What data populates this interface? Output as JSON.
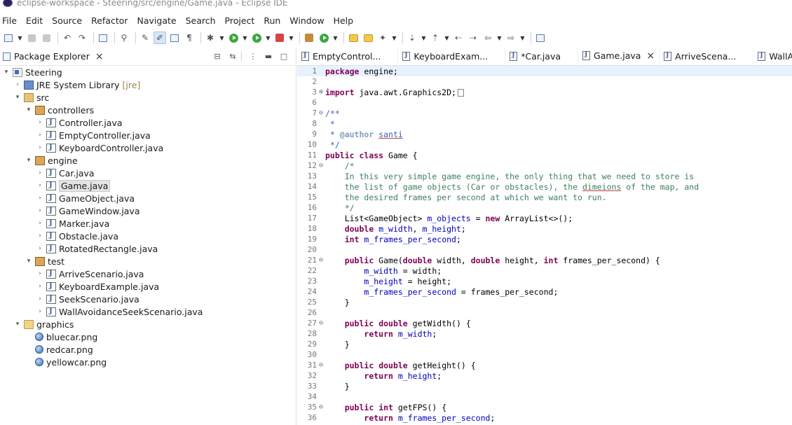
{
  "window": {
    "title": "eclipse-workspace - Steering/src/engine/Game.java - Eclipse IDE"
  },
  "menubar": {
    "items": [
      "File",
      "Edit",
      "Source",
      "Refactor",
      "Navigate",
      "Search",
      "Project",
      "Run",
      "Window",
      "Help"
    ]
  },
  "toolbar": {
    "icons": [
      "new-icon",
      "save-icon",
      "save-all-icon",
      "undo-icon",
      "redo-icon",
      "terminal-icon",
      "toggle-breakpoint-icon",
      "open-type-icon",
      "mark-occurrences-icon",
      "show-whitespace-icon",
      "debug-icon",
      "run-icon",
      "run-coverage-icon",
      "external-tools-icon",
      "new-java-package-icon",
      "new-java-class-icon",
      "open-task-icon",
      "search-icon",
      "next-annotation-icon",
      "previous-annotation-icon",
      "last-edit-icon",
      "back-icon",
      "forward-icon",
      "pin-editor-icon"
    ]
  },
  "explorer": {
    "tab_label": "Package Explorer",
    "tree": [
      {
        "label": "Steering",
        "icon": "project-icon",
        "level": 0,
        "expanded": true
      },
      {
        "label": "JRE System Library",
        "decoration": "[jre]",
        "icon": "library-icon",
        "level": 1,
        "expanded": false
      },
      {
        "label": "src",
        "icon": "source-folder-icon",
        "level": 1,
        "expanded": true
      },
      {
        "label": "controllers",
        "icon": "package-icon",
        "level": 2,
        "expanded": true
      },
      {
        "label": "Controller.java",
        "icon": "java-file-icon",
        "level": 3,
        "expanded": false
      },
      {
        "label": "EmptyController.java",
        "icon": "java-file-icon",
        "level": 3,
        "expanded": false
      },
      {
        "label": "KeyboardController.java",
        "icon": "java-file-icon",
        "level": 3,
        "expanded": false
      },
      {
        "label": "engine",
        "icon": "package-icon",
        "level": 2,
        "expanded": true
      },
      {
        "label": "Car.java",
        "icon": "java-file-icon",
        "level": 3,
        "expanded": false
      },
      {
        "label": "Game.java",
        "icon": "java-file-icon",
        "level": 3,
        "expanded": false,
        "selected": true
      },
      {
        "label": "GameObject.java",
        "icon": "java-file-icon",
        "level": 3,
        "expanded": false
      },
      {
        "label": "GameWindow.java",
        "icon": "java-file-icon",
        "level": 3,
        "expanded": false
      },
      {
        "label": "Marker.java",
        "icon": "java-file-icon",
        "level": 3,
        "expanded": false
      },
      {
        "label": "Obstacle.java",
        "icon": "java-file-icon",
        "level": 3,
        "expanded": false
      },
      {
        "label": "RotatedRectangle.java",
        "icon": "java-file-icon",
        "level": 3,
        "expanded": false
      },
      {
        "label": "test",
        "icon": "package-icon",
        "level": 2,
        "expanded": true
      },
      {
        "label": "ArriveScenario.java",
        "icon": "java-file-icon",
        "level": 3,
        "expanded": false
      },
      {
        "label": "KeyboardExample.java",
        "icon": "java-file-icon",
        "level": 3,
        "expanded": false
      },
      {
        "label": "SeekScenario.java",
        "icon": "java-file-icon",
        "level": 3,
        "expanded": false
      },
      {
        "label": "WallAvoidanceSeekScenario.java",
        "icon": "java-file-icon",
        "level": 3,
        "expanded": false
      },
      {
        "label": "graphics",
        "icon": "folder-icon",
        "level": 1,
        "expanded": true
      },
      {
        "label": "bluecar.png",
        "icon": "image-file-icon",
        "level": 2,
        "leaf": true
      },
      {
        "label": "redcar.png",
        "icon": "image-file-icon",
        "level": 2,
        "leaf": true
      },
      {
        "label": "yellowcar.png",
        "icon": "image-file-icon",
        "level": 2,
        "leaf": true
      }
    ]
  },
  "editor": {
    "tabs": [
      {
        "label": "EmptyControl...",
        "active": false
      },
      {
        "label": "KeyboardExam...",
        "active": false
      },
      {
        "label": "*Car.java",
        "active": false
      },
      {
        "label": "Game.java",
        "active": true
      },
      {
        "label": "ArriveScena...",
        "active": false
      },
      {
        "label": "WallAvoidanc...",
        "active": false
      }
    ],
    "lines": [
      {
        "n": "1",
        "fold": "",
        "html": "<span class=\"kw\">package</span> engine;",
        "current": true
      },
      {
        "n": "2",
        "fold": "",
        "html": ""
      },
      {
        "n": "3",
        "fold": "⊕",
        "html": "<span class=\"kw\">import</span> java.awt.Graphics2D;<span class=\"folded-box\"></span>"
      },
      {
        "n": "6",
        "fold": "",
        "html": ""
      },
      {
        "n": "7",
        "fold": "⊖",
        "html": "<span class=\"jd\">/**</span>"
      },
      {
        "n": "8",
        "fold": "",
        "html": "<span class=\"jd\"> *</span>"
      },
      {
        "n": "9",
        "fold": "",
        "html": "<span class=\"jd\"> * </span><span class=\"jdtag\">@author</span><span class=\"jd\"> <span class=\"ul\">santi</span></span>"
      },
      {
        "n": "10",
        "fold": "",
        "html": "<span class=\"jd\"> */</span>"
      },
      {
        "n": "11",
        "fold": "",
        "html": "<span class=\"kw\">public</span> <span class=\"kw\">class</span> Game {"
      },
      {
        "n": "12",
        "fold": "⊖",
        "html": "    <span class=\"cm\">/*</span>"
      },
      {
        "n": "13",
        "fold": "",
        "html": "    <span class=\"cm\">In this very simple game engine, the only thing that we need to store is</span>"
      },
      {
        "n": "14",
        "fold": "",
        "html": "    <span class=\"cm\">the list of game objects (Car or obstacles), the <span class=\"ul\">dimeions</span> of the map, and</span>"
      },
      {
        "n": "15",
        "fold": "",
        "html": "    <span class=\"cm\">the desired frames per second at which we want to run.</span>"
      },
      {
        "n": "16",
        "fold": "",
        "html": "    <span class=\"cm\">*/</span>"
      },
      {
        "n": "17",
        "fold": "",
        "html": "    List&lt;GameObject&gt; <span class=\"field\">m_objects</span> = <span class=\"kw\">new</span> ArrayList&lt;&gt;();"
      },
      {
        "n": "18",
        "fold": "",
        "html": "    <span class=\"kw\">double</span> <span class=\"field\">m_width</span>, <span class=\"field\">m_height</span>;"
      },
      {
        "n": "19",
        "fold": "",
        "html": "    <span class=\"kw\">int</span> <span class=\"field\">m_frames_per_second</span>;"
      },
      {
        "n": "20",
        "fold": "",
        "html": ""
      },
      {
        "n": "21",
        "fold": "⊖",
        "html": "    <span class=\"kw\">public</span> Game(<span class=\"kw\">double</span> width, <span class=\"kw\">double</span> height, <span class=\"kw\">int</span> frames_per_second) {"
      },
      {
        "n": "22",
        "fold": "",
        "html": "        <span class=\"field\">m_width</span> = width;"
      },
      {
        "n": "23",
        "fold": "",
        "html": "        <span class=\"field\">m_height</span> = height;"
      },
      {
        "n": "24",
        "fold": "",
        "html": "        <span class=\"field\">m_frames_per_second</span> = frames_per_second;"
      },
      {
        "n": "25",
        "fold": "",
        "html": "    }"
      },
      {
        "n": "26",
        "fold": "",
        "html": ""
      },
      {
        "n": "27",
        "fold": "⊖",
        "html": "    <span class=\"kw\">public</span> <span class=\"kw\">double</span> getWidth() {"
      },
      {
        "n": "28",
        "fold": "",
        "html": "        <span class=\"kw\">return</span> <span class=\"field\">m_width</span>;"
      },
      {
        "n": "29",
        "fold": "",
        "html": "    }"
      },
      {
        "n": "30",
        "fold": "",
        "html": ""
      },
      {
        "n": "31",
        "fold": "⊖",
        "html": "    <span class=\"kw\">public</span> <span class=\"kw\">double</span> getHeight() {"
      },
      {
        "n": "32",
        "fold": "",
        "html": "        <span class=\"kw\">return</span> <span class=\"field\">m_height</span>;"
      },
      {
        "n": "33",
        "fold": "",
        "html": "    }"
      },
      {
        "n": "34",
        "fold": "",
        "html": ""
      },
      {
        "n": "35",
        "fold": "⊖",
        "html": "    <span class=\"kw\">public</span> <span class=\"kw\">int</span> getFPS() {"
      },
      {
        "n": "36",
        "fold": "",
        "html": "        <span class=\"kw\">return</span> <span class=\"field\">m_frames_per_second</span>;"
      }
    ]
  },
  "colors": {
    "keyword": "#7f0055",
    "comment": "#3f7f5f",
    "javadoc": "#3f5fbf",
    "field": "#0000c0",
    "current_line": "#e8f2fe"
  }
}
